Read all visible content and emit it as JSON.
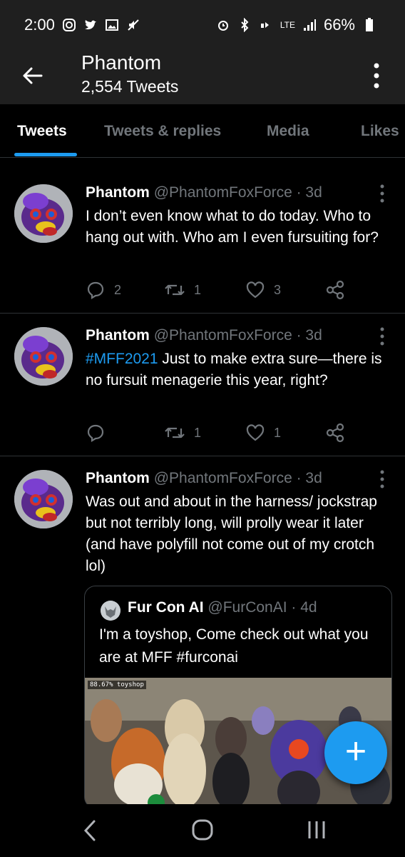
{
  "status_bar": {
    "time": "2:00",
    "battery": "66%",
    "network": "LTE"
  },
  "header": {
    "title": "Phantom",
    "subtitle": "2,554 Tweets"
  },
  "tabs": [
    {
      "label": "Tweets",
      "active": true
    },
    {
      "label": "Tweets & replies",
      "active": false
    },
    {
      "label": "Media",
      "active": false
    },
    {
      "label": "Likes",
      "active": false
    }
  ],
  "tweets": [
    {
      "name": "Phantom",
      "meta": "@PhantomFoxForce · 3d",
      "text": "I don’t even know what to do today. Who to hang out with.  Who am I even fursuiting for?",
      "hashtag": "",
      "replies": "2",
      "retweets": "1",
      "likes": "3"
    },
    {
      "name": "Phantom",
      "meta": "@PhantomFoxForce · 3d",
      "hashtag": "#MFF2021",
      "text": " Just to make extra sure—there is no fursuit menagerie this year, right?",
      "replies": "",
      "retweets": "1",
      "likes": "1"
    },
    {
      "name": "Phantom",
      "meta": "@PhantomFoxForce · 3d",
      "text": "Was out and about in the harness/ jockstrap but not terribly long, will prolly wear it later (and have polyfill not come out of my crotch lol)",
      "hashtag": ""
    }
  ],
  "quote": {
    "name": "Fur Con AI",
    "meta": "@FurConAI · 4d",
    "text": "I'm a toyshop, Come check out what you are at MFF #furconai",
    "media_label": "88.67% toyshop"
  },
  "colors": {
    "accent": "#1d9bf0",
    "muted": "#71767b",
    "divider": "#2f3336",
    "header_bg": "#1f1f1f"
  },
  "icons": {
    "back": "arrow-left-icon",
    "more": "vertical-dots-icon",
    "reply": "reply-icon",
    "retweet": "retweet-icon",
    "like": "heart-icon",
    "share": "share-icon",
    "compose": "plus-icon"
  }
}
